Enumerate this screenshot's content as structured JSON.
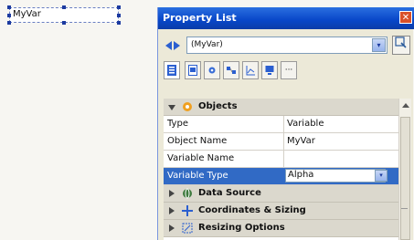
{
  "canvas": {
    "widget_text": "MyVar"
  },
  "panel": {
    "title": "Property List",
    "close_glyph": "✕",
    "object_selector": {
      "value": "(MyVar)",
      "dropdown_glyph": "▾"
    },
    "picker_icon": "select-object-icon",
    "tabs": [
      {
        "icon": "list-icon"
      },
      {
        "icon": "form-icon"
      },
      {
        "icon": "gear-icon"
      },
      {
        "icon": "events-icon"
      },
      {
        "icon": "chart-icon"
      },
      {
        "icon": "monitor-icon"
      },
      {
        "icon": "more-icon",
        "label": "···"
      }
    ],
    "sections": {
      "objects": {
        "label": "Objects",
        "expanded": true
      },
      "data_source": {
        "label": "Data Source",
        "expanded": false
      },
      "coordinates": {
        "label": "Coordinates & Sizing",
        "expanded": false
      },
      "resizing": {
        "label": "Resizing Options",
        "expanded": false
      }
    },
    "properties": [
      {
        "name": "Type",
        "value": "Variable"
      },
      {
        "name": "Object Name",
        "value": "MyVar"
      },
      {
        "name": "Variable Name",
        "value": ""
      }
    ],
    "selected_property": {
      "name": "Variable Type",
      "value": "Alpha"
    }
  }
}
